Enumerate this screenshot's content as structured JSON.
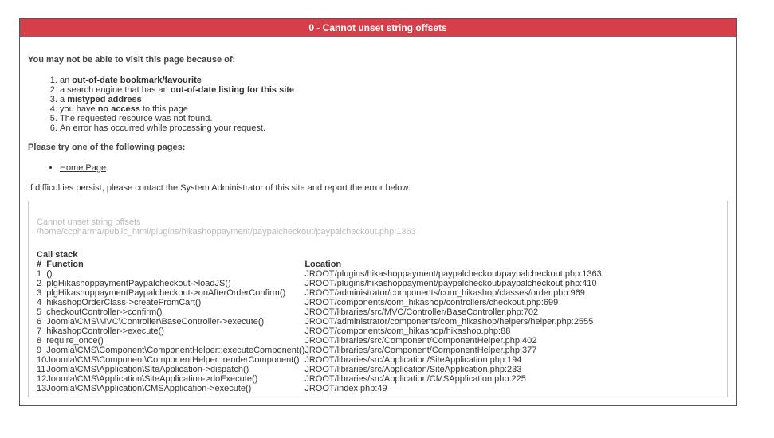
{
  "header": {
    "title": "0 - Cannot unset string offsets"
  },
  "reasons": {
    "title": "You may not be able to visit this page because of:",
    "items": [
      {
        "pre": "an ",
        "bold": "out-of-date bookmark/favourite",
        "post": ""
      },
      {
        "pre": "a search engine that has an ",
        "bold": "out-of-date listing for this site",
        "post": ""
      },
      {
        "pre": "a ",
        "bold": "mistyped address",
        "post": ""
      },
      {
        "pre": "you have ",
        "bold": "no access",
        "post": " to this page"
      },
      {
        "pre": "The requested resource was not found.",
        "bold": "",
        "post": ""
      },
      {
        "pre": "An error has occurred while processing your request.",
        "bold": "",
        "post": ""
      }
    ]
  },
  "pages": {
    "title": "Please try one of the following pages:",
    "links": [
      "Home Page"
    ]
  },
  "persist_text": "If difficulties persist, please contact the System Administrator of this site and report the error below.",
  "error": {
    "message": "Cannot unset string offsets",
    "path": "/home/ccpharma/public_html/plugins/hikashoppayment/paypalcheckout/paypalcheckout.php:1363"
  },
  "callstack": {
    "title": "Call stack",
    "headers": {
      "num": "#",
      "function": "Function",
      "location": "Location"
    },
    "rows": [
      {
        "num": "1",
        "function": "()",
        "location": "JROOT/plugins/hikashoppayment/paypalcheckout/paypalcheckout.php:1363"
      },
      {
        "num": "2",
        "function": "plgHikashoppaymentPaypalcheckout->loadJS()",
        "location": "JROOT/plugins/hikashoppayment/paypalcheckout/paypalcheckout.php:410"
      },
      {
        "num": "3",
        "function": "plgHikashoppaymentPaypalcheckout->onAfterOrderConfirm()",
        "location": "JROOT/administrator/components/com_hikashop/classes/order.php:969"
      },
      {
        "num": "4",
        "function": "hikashopOrderClass->createFromCart()",
        "location": "JROOT/components/com_hikashop/controllers/checkout.php:699"
      },
      {
        "num": "5",
        "function": "checkoutController->confirm()",
        "location": "JROOT/libraries/src/MVC/Controller/BaseController.php:702"
      },
      {
        "num": "6",
        "function": "Joomla\\CMS\\MVC\\Controller\\BaseController->execute()",
        "location": "JROOT/administrator/components/com_hikashop/helpers/helper.php:2555"
      },
      {
        "num": "7",
        "function": "hikashopController->execute()",
        "location": "JROOT/components/com_hikashop/hikashop.php:88"
      },
      {
        "num": "8",
        "function": "require_once()",
        "location": "JROOT/libraries/src/Component/ComponentHelper.php:402"
      },
      {
        "num": "9",
        "function": "Joomla\\CMS\\Component\\ComponentHelper::executeComponent()",
        "location": "JROOT/libraries/src/Component/ComponentHelper.php:377"
      },
      {
        "num": "10",
        "function": "Joomla\\CMS\\Component\\ComponentHelper::renderComponent()",
        "location": "JROOT/libraries/src/Application/SiteApplication.php:194"
      },
      {
        "num": "11",
        "function": "Joomla\\CMS\\Application\\SiteApplication->dispatch()",
        "location": "JROOT/libraries/src/Application/SiteApplication.php:233"
      },
      {
        "num": "12",
        "function": "Joomla\\CMS\\Application\\SiteApplication->doExecute()",
        "location": "JROOT/libraries/src/Application/CMSApplication.php:225"
      },
      {
        "num": "13",
        "function": "Joomla\\CMS\\Application\\CMSApplication->execute()",
        "location": "JROOT/index.php:49"
      }
    ]
  },
  "colors": {
    "header_bg": "#d43f4a",
    "header_text": "#ffffff",
    "muted_text": "#bbbbbb"
  }
}
